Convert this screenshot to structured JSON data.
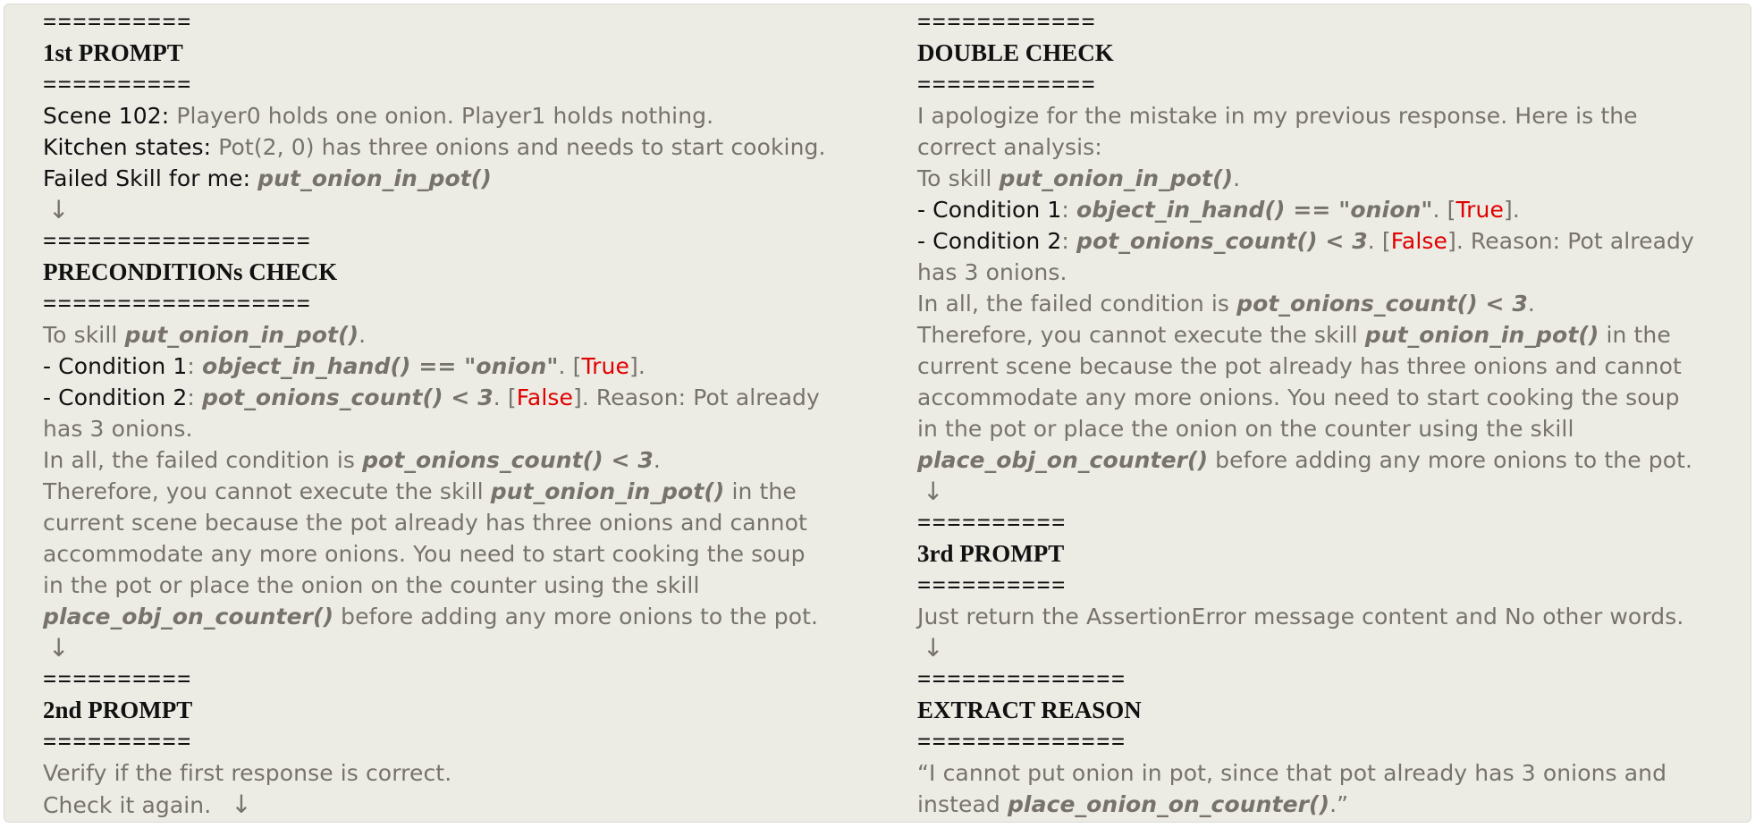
{
  "left": {
    "sep1": "==========",
    "h1": "1st PROMPT",
    "sep2": "==========",
    "scene_label": "Scene 102:",
    "scene_text": " Player0 holds one onion. Player1 holds nothing.",
    "kitchen_label": "Kitchen states:",
    "kitchen_text": " Pot(2, 0) has three onions and needs to start cooking.",
    "failed_label": "Failed Skill for me:",
    "failed_skill": "put_onion_in_pot()",
    "arrow1": "↓",
    "sep3": "==================",
    "h2": "PRECONDITIONs CHECK",
    "sep4": "==================",
    "to_skill_pre": "To skill ",
    "to_skill_fn": "put_onion_in_pot()",
    "to_skill_post": ".",
    "c1_label": "- Condition 1",
    "c1_colon": ": ",
    "c1_fn": "object_in_hand() == \"onion\"",
    "c1_mid": ". [",
    "c1_val": "True",
    "c1_end": "].",
    "c2_label": "- Condition 2",
    "c2_colon": ": ",
    "c2_fn": "pot_onions_count() < 3",
    "c2_mid": ". [",
    "c2_val": "False",
    "c2_end": "]. Reason: Pot already",
    "c2_cont": "has 3 onions.",
    "inall_pre": "In all, the failed condition is ",
    "inall_fn": "pot_onions_count() < 3",
    "inall_post": ".",
    "there_pre": "Therefore, you cannot execute the skill ",
    "there_fn": "put_onion_in_pot()",
    "there_post": " in the",
    "p2": "current scene because the pot already has three onions and cannot",
    "p3": "accommodate any more onions. You need to start cooking the soup",
    "p4": "in the pot or place the onion on the counter using the skill",
    "p5_fn": "place_obj_on_counter()",
    "p5_post": " before adding any more onions to the pot.",
    "arrow2": "↓",
    "sep5": "==========",
    "h3": "2nd PROMPT",
    "sep6": "==========",
    "verify": "Verify if the first response is correct.",
    "check": "Check it again.",
    "arrow3": "↓"
  },
  "right": {
    "sep1": "============",
    "h1": "DOUBLE CHECK",
    "sep2": "============",
    "apol1": "I apologize for the mistake in my previous response. Here is the",
    "apol2": "correct analysis:",
    "to_skill_pre": "To skill ",
    "to_skill_fn": "put_onion_in_pot()",
    "to_skill_post": ".",
    "c1_label": "- Condition 1",
    "c1_colon": ": ",
    "c1_fn": "object_in_hand() == \"onion\"",
    "c1_mid": ". [",
    "c1_val": "True",
    "c1_end": "].",
    "c2_label": "- Condition 2",
    "c2_colon": ": ",
    "c2_fn": "pot_onions_count() < 3",
    "c2_mid": ". [",
    "c2_val": "False",
    "c2_end": "]. Reason: Pot already",
    "c2_cont": "has 3 onions.",
    "inall_pre": "In all, the failed condition is ",
    "inall_fn": "pot_onions_count() < 3",
    "inall_post": ".",
    "there_pre": "Therefore, you cannot execute the skill ",
    "there_fn": "put_onion_in_pot()",
    "there_post": " in the",
    "p2": "current scene because the pot already has three onions and cannot",
    "p3": "accommodate any more onions. You need to start cooking the soup",
    "p4": "in the pot or place the onion on the counter using the skill",
    "p5_fn": "place_obj_on_counter()",
    "p5_post": " before adding any more onions to the pot.",
    "arrow1": "↓",
    "sep3": "==========",
    "h2": "3rd PROMPT",
    "sep4": "==========",
    "just": "Just return the AssertionError message content and No other words.",
    "arrow2": "↓",
    "sep5": "==============",
    "h3": "EXTRACT REASON",
    "sep6": "==============",
    "q1": "“I cannot put onion in pot, since that pot already has 3 onions and",
    "q2_pre": "instead ",
    "q2_fn": "place_onion_on_counter()",
    "q2_post": ".”"
  }
}
